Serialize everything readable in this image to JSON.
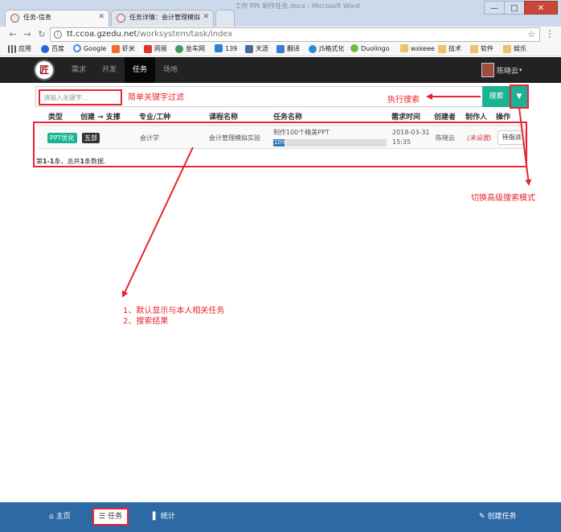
{
  "browser": {
    "window_title": "工作 PPt 制作任务.docx - Microsoft Word",
    "window_buttons": {
      "minimize": "—",
      "maximize": "□",
      "close": "✕"
    },
    "tabs": [
      {
        "label": "任务-信息",
        "active": true
      },
      {
        "label": "任务详情：会计管理模拟",
        "active": false
      }
    ],
    "address": {
      "host": "tt.ccoa.gzedu.net",
      "path": "/worksystem/task/index"
    },
    "bookmarks": [
      {
        "label": "应用",
        "icon": "apps-icon"
      },
      {
        "label": "百度",
        "icon": "baidu-icon"
      },
      {
        "label": "Google",
        "icon": "google-icon"
      },
      {
        "label": "虾米",
        "icon": "xiami-icon"
      },
      {
        "label": "网易",
        "icon": "netease-icon"
      },
      {
        "label": "坐车网",
        "icon": "zuoche-icon"
      },
      {
        "label": "139",
        "icon": "mail139-icon"
      },
      {
        "label": "天涯",
        "icon": "tianya-icon"
      },
      {
        "label": "翻译",
        "icon": "translate-icon"
      },
      {
        "label": "JS格式化",
        "icon": "jsformat-icon"
      },
      {
        "label": "Duolingo",
        "icon": "duolingo-icon"
      },
      {
        "label": "wskeee",
        "icon": "folder-icon"
      },
      {
        "label": "技术",
        "icon": "folder-icon"
      },
      {
        "label": "软件",
        "icon": "folder-icon"
      },
      {
        "label": "娱乐",
        "icon": "folder-icon"
      }
    ]
  },
  "nav": {
    "logo_glyph": "匠",
    "items": [
      "需求",
      "开发",
      "任务",
      "场地"
    ],
    "active_index": 2,
    "user_name": "陈晓云"
  },
  "search": {
    "placeholder": "请输入关键字...",
    "button_label": "搜索",
    "toggle_glyph": "▼"
  },
  "annotations": {
    "simple_filter": "简单关键字过滤",
    "execute_search": "执行搜索",
    "toggle_advanced": "切换高级搜索模式",
    "result_note_1": "1、默认显示与本人相关任务",
    "result_note_2": "2、搜索结果"
  },
  "table": {
    "headers": [
      "类型",
      "创建 → 支撑",
      "专业/工种",
      "课程名称",
      "任务名称",
      "需求时间",
      "创建者",
      "制作人",
      "操作"
    ],
    "rows": [
      {
        "type_badge": "PPT优化",
        "dept_badge": "五部",
        "major": "会计学",
        "course": "会计管理模拟实验",
        "task_name": "制作100个精美PPT",
        "progress": 10,
        "progress_label": "10%",
        "date": "2018-03-31",
        "time": "15:35",
        "creator": "陈晓云",
        "maker": "(未设置)",
        "action": "待指派"
      }
    ],
    "summary": {
      "prefix": "第",
      "range": "1-1",
      "mid": "条，总共",
      "total": "1",
      "suffix": "条数据."
    }
  },
  "footer": {
    "items": [
      {
        "label": "主页",
        "icon": "home-icon"
      },
      {
        "label": "任务",
        "icon": "list-icon"
      },
      {
        "label": "统计",
        "icon": "bar-chart-icon"
      },
      {
        "label": "创建任务",
        "icon": "edit-icon"
      }
    ]
  },
  "colors": {
    "accent": "#1bb394",
    "annotation": "#e8232b",
    "navbar": "#222222",
    "footer": "#2d6aa5",
    "progress": "#337ab7"
  }
}
